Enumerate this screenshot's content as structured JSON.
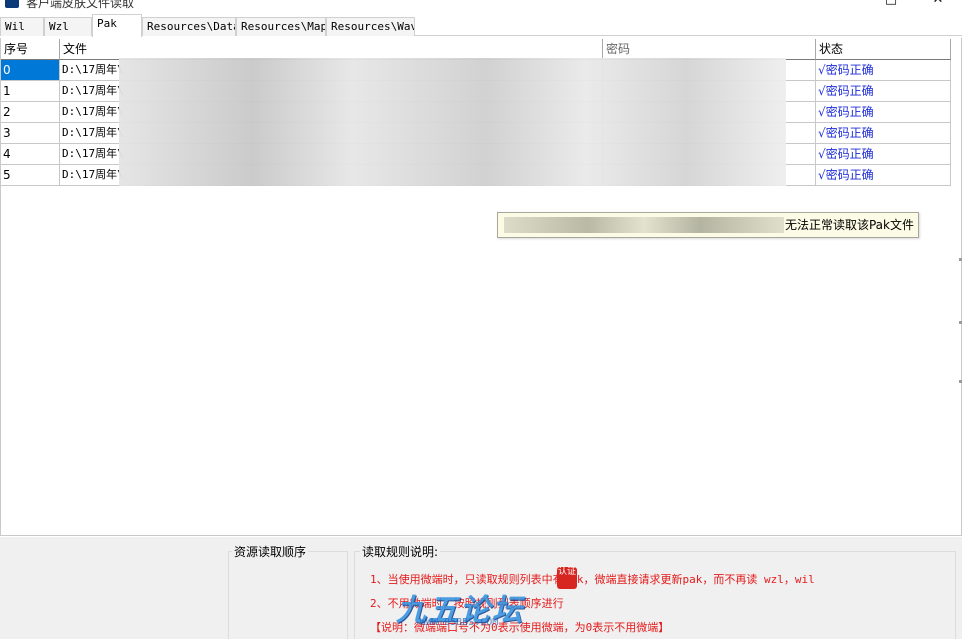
{
  "window": {
    "title": "客户端皮肤文件读取",
    "icon": "app-logo-icon",
    "maximize_glyph": "□",
    "close_glyph": "✕"
  },
  "tabs": [
    {
      "label": "Wil",
      "active": false
    },
    {
      "label": "Wzl",
      "active": false
    },
    {
      "label": "Pak",
      "active": true
    },
    {
      "label": "Resources\\Data",
      "active": false
    },
    {
      "label": "Resources\\Map",
      "active": false
    },
    {
      "label": "Resources\\Wav",
      "active": false
    }
  ],
  "table": {
    "columns": [
      "序号",
      "文件",
      "密码",
      "状态"
    ],
    "rows": [
      {
        "index": "0",
        "file": "D:\\17周年\\",
        "status": "√密码正确",
        "selected": true
      },
      {
        "index": "1",
        "file": "D:\\17周年\\",
        "status": "√密码正确",
        "selected": false
      },
      {
        "index": "2",
        "file": "D:\\17周年\\",
        "status": "√密码正确",
        "selected": false
      },
      {
        "index": "3",
        "file": "D:\\17周年\\",
        "status": "√密码正确",
        "selected": false
      },
      {
        "index": "4",
        "file": "D:\\17周年\\",
        "status": "√密码正确",
        "selected": false
      },
      {
        "index": "5",
        "file": "D:\\17周年\\",
        "status": "√密码正确",
        "selected": false
      }
    ],
    "status_color": "#1c2bd6",
    "selection_color": "#0078d7"
  },
  "tooltip": {
    "message": "无法正常读取该Pak文件"
  },
  "bottom": {
    "read_order_title": "资源读取顺序",
    "rules_title": "读取规则说明:",
    "rule_lines": [
      "1、当使用微端时，只读取规则列表中有pak，微端直接请求更新pak，而不再读 wzl，wil",
      "2、不用微端时，按照规则列表顺序进行",
      "【说明：微端端口号不为0表示使用微端，为0表示不用微端】"
    ],
    "rule_color": "#e41b1b"
  },
  "watermark": {
    "text": "九五论坛",
    "sub": "WWW.95BBS.COM",
    "seal": "认证"
  }
}
